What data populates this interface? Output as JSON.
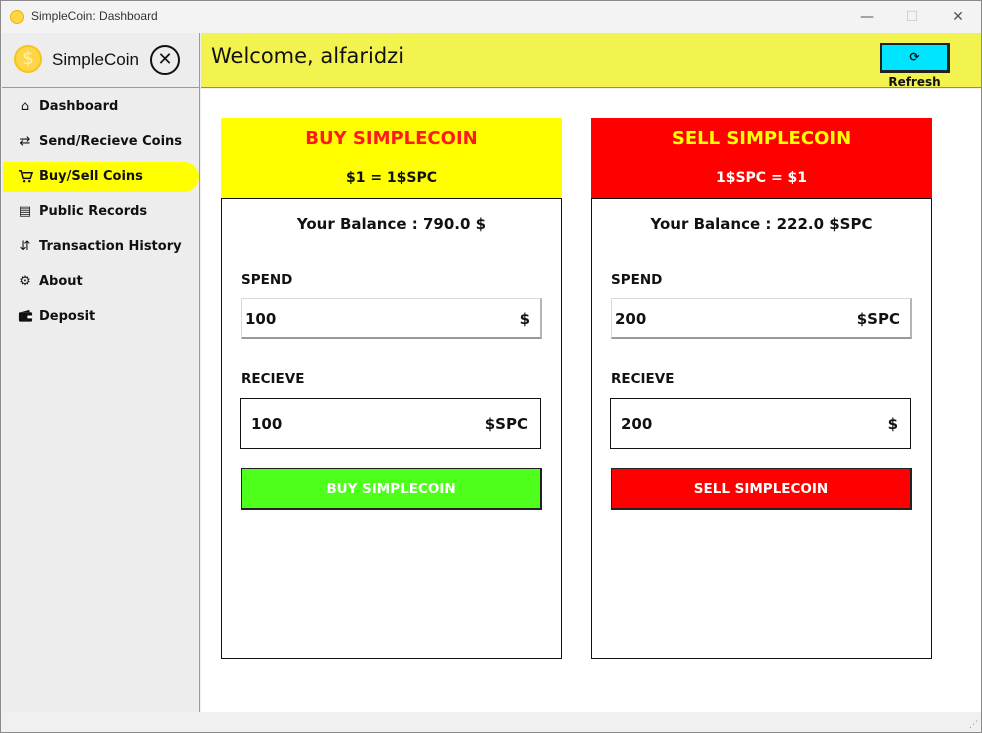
{
  "window": {
    "title": "SimpleCoin: Dashboard",
    "min_glyph": "—",
    "max_glyph": "☐",
    "close_glyph": "✕"
  },
  "sidebar": {
    "brand_name": "SimpleCoin",
    "brand_icon": "coin-icon",
    "close_icon_glyph": "✕",
    "items": [
      {
        "label": "Dashboard",
        "icon": "home-icon",
        "glyph": "⌂",
        "active": false
      },
      {
        "label": "Send/Recieve Coins",
        "icon": "transfer-icon",
        "glyph": "⇄",
        "active": false
      },
      {
        "label": "Buy/Sell Coins",
        "icon": "cart-icon",
        "glyph": "🛒",
        "active": true
      },
      {
        "label": "Public Records",
        "icon": "records-icon",
        "glyph": "▤",
        "active": false
      },
      {
        "label": "Transaction History",
        "icon": "history-icon",
        "glyph": "⇵",
        "active": false
      },
      {
        "label": "About",
        "icon": "gear-icon",
        "glyph": "⚙",
        "active": false
      },
      {
        "label": "Deposit",
        "icon": "wallet-icon",
        "glyph": "▰",
        "active": false
      }
    ]
  },
  "header": {
    "welcome": "Welcome, alfaridzi",
    "refresh_label": "Refresh",
    "refresh_glyph": "⟳"
  },
  "buy_panel": {
    "title": "BUY SIMPLECOIN",
    "rate": "$1 = 1$SPC",
    "balance": "Your Balance : 790.0 $",
    "spend_label": "SPEND",
    "spend_value": "100",
    "spend_unit": "$",
    "receive_label": "RECIEVE",
    "receive_value": "100",
    "receive_unit": "$SPC",
    "action_label": "BUY SIMPLECOIN"
  },
  "sell_panel": {
    "title": "SELL SIMPLECOIN",
    "rate": "1$SPC = $1",
    "balance": "Your Balance : 222.0 $SPC",
    "spend_label": "SPEND",
    "spend_value": "200",
    "spend_unit": "$SPC",
    "receive_label": "RECIEVE",
    "receive_value": "200",
    "receive_unit": "$",
    "action_label": "SELL SIMPLECOIN"
  },
  "colors": {
    "header_bg": "#f3f350",
    "active_nav": "#ffff00",
    "buy_head": "#ffff00",
    "sell_head": "#ff0000",
    "buy_button": "#4dff1a",
    "sell_button": "#ff0000",
    "refresh_button": "#00e5ff"
  }
}
